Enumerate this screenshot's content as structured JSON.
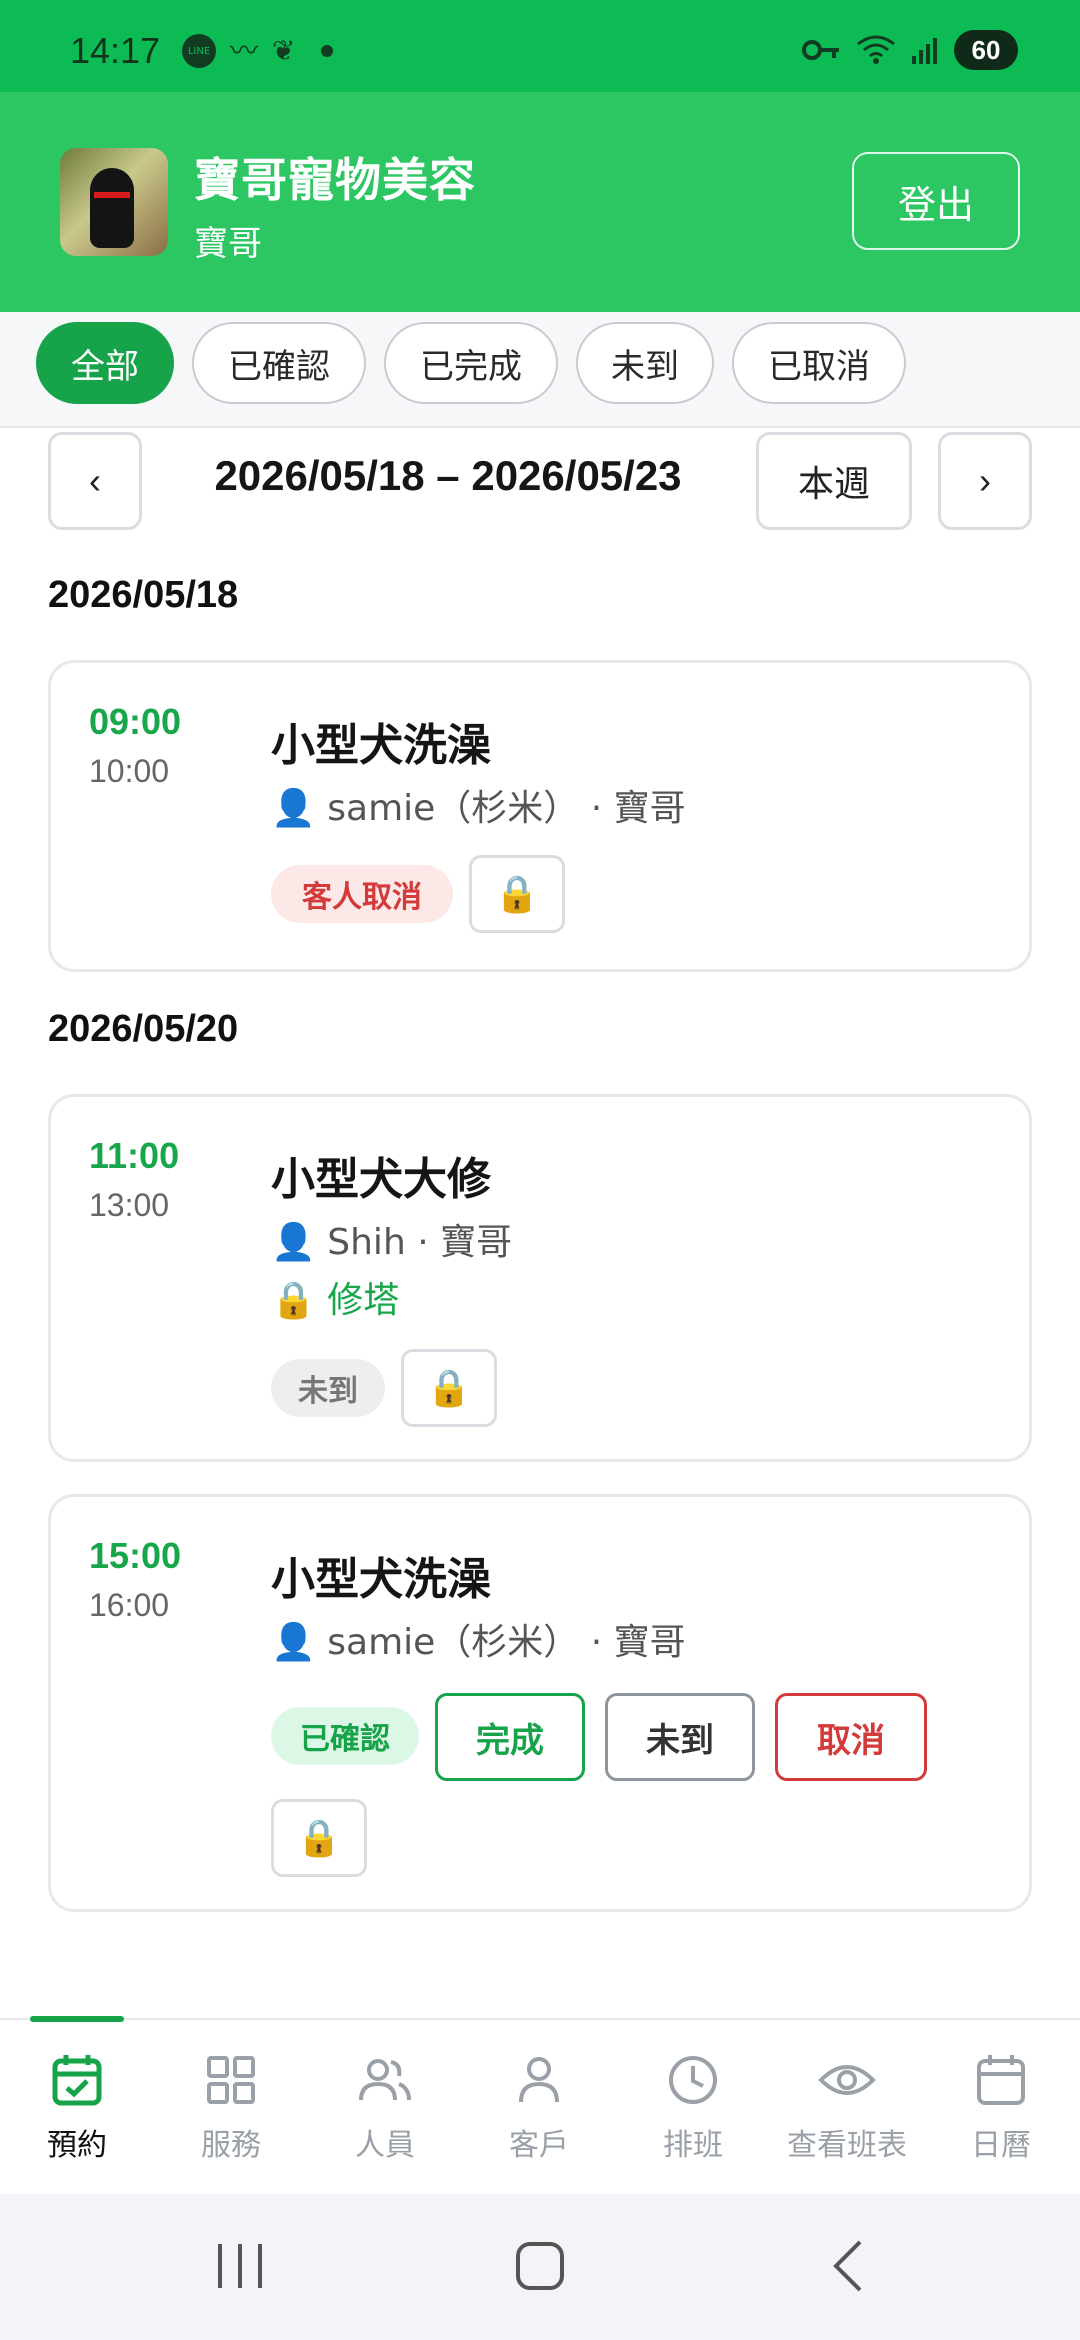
{
  "status_bar": {
    "time": "14:17",
    "left_icons": [
      "line-icon",
      "bird-icon",
      "plant-icon"
    ],
    "right_icons": [
      "key-icon",
      "wifi-icon",
      "signal-icon"
    ],
    "battery": "60"
  },
  "header": {
    "shop_name": "寶哥寵物美容",
    "owner": "寶哥",
    "logout_label": "登出"
  },
  "filters": [
    {
      "label": "全部",
      "active": true
    },
    {
      "label": "已確認",
      "active": false
    },
    {
      "label": "已完成",
      "active": false
    },
    {
      "label": "未到",
      "active": false
    },
    {
      "label": "已取消",
      "active": false
    }
  ],
  "week_nav": {
    "prev": "‹",
    "range": "2026/05/18 – 2026/05/23",
    "this_week": "本週",
    "next": "›"
  },
  "days": [
    {
      "date": "2026/05/18",
      "appointments": [
        {
          "start": "09:00",
          "end": "10:00",
          "service": "小型犬洗澡",
          "who": "👤 samie（杉米） · 寶哥",
          "status": "客人取消",
          "lock": "🔒"
        }
      ]
    },
    {
      "date": "2026/05/20",
      "appointments": [
        {
          "start": "11:00",
          "end": "13:00",
          "service": "小型犬大修",
          "who": "👤 Shih · 寶哥",
          "lock_note": "🔒 修塔",
          "status": "未到",
          "lock": "🔒"
        },
        {
          "start": "15:00",
          "end": "16:00",
          "service": "小型犬洗澡",
          "who": "👤 samie（杉米） · 寶哥",
          "status": "已確認",
          "actions": {
            "done": "完成",
            "no_show": "未到",
            "cancel": "取消"
          },
          "lock": "🔒"
        }
      ]
    }
  ],
  "bottom_nav": [
    {
      "label": "預約",
      "icon": "calendar-check-icon",
      "active": true
    },
    {
      "label": "服務",
      "icon": "grid-icon",
      "active": false
    },
    {
      "label": "人員",
      "icon": "users-icon",
      "active": false
    },
    {
      "label": "客戶",
      "icon": "user-icon",
      "active": false
    },
    {
      "label": "排班",
      "icon": "clock-icon",
      "active": false
    },
    {
      "label": "查看班表",
      "icon": "eye-icon",
      "active": false
    },
    {
      "label": "日曆",
      "icon": "calendar-icon",
      "active": false
    }
  ],
  "colors": {
    "status_bar": "#0cbb53",
    "header": "#2cc663",
    "accent": "#16a34a",
    "danger": "#d33a3a"
  }
}
